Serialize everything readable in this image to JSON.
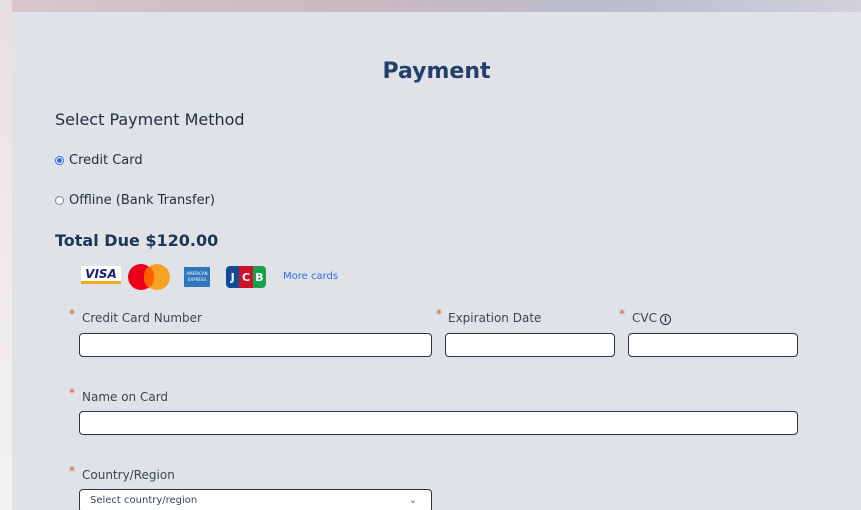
{
  "title": "Payment",
  "payment_method": {
    "section_title": "Select Payment Method",
    "options": [
      {
        "label": "Credit Card",
        "selected": true
      },
      {
        "label": "Offline (Bank Transfer)",
        "selected": false
      }
    ]
  },
  "total_due": "Total Due $120.00",
  "cards": {
    "visa": "VISA",
    "amex": "AMERICAN EXPRESS",
    "jcb": [
      "J",
      "C",
      "B"
    ],
    "more_link": "More cards"
  },
  "form": {
    "required_mark": "*",
    "card_number": {
      "label": "Credit Card Number",
      "value": ""
    },
    "expiration": {
      "label": "Expiration Date",
      "value": ""
    },
    "cvc": {
      "label": "CVC",
      "value": "",
      "info_icon": "i"
    },
    "name_on_card": {
      "label": "Name on Card",
      "value": ""
    },
    "country": {
      "label": "Country/Region",
      "placeholder": "Select country/region",
      "chevron": "⌄"
    }
  },
  "colors": {
    "title": "#24406a",
    "panel": "#dfe3e8",
    "radio_selected": "#2f6fd8",
    "required": "#d6502a"
  }
}
